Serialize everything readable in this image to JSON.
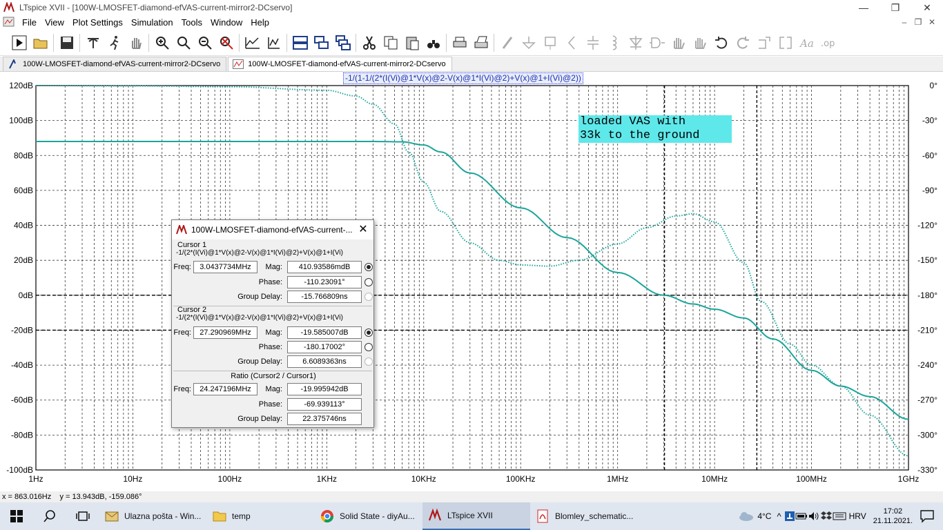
{
  "window": {
    "title": "LTspice XVII - [100W-LMOSFET-diamond-efVAS-current-mirror2-DCservo]",
    "controls": [
      "—",
      "❐",
      "✕"
    ]
  },
  "menu": {
    "items": [
      "File",
      "View",
      "Plot Settings",
      "Simulation",
      "Tools",
      "Window",
      "Help"
    ],
    "mdi_controls": [
      "–",
      "❐",
      "✕"
    ]
  },
  "toolbar": {
    "buttons": [
      "run-icon",
      "open-icon",
      "save-icon",
      "control-panel-icon",
      "run-man-icon",
      "pan-hand-icon",
      "zoom-in-icon",
      "zoom-full-icon",
      "zoom-out-icon",
      "zoom-cancel-icon",
      "autorange-icon",
      "add-trace-icon",
      "tile-h-icon",
      "tile-v-icon",
      "cascade-icon",
      "cut-icon",
      "copy-icon",
      "paste-icon",
      "find-icon",
      "print-icon",
      "print-setup-icon",
      "wire-icon",
      "ground-icon",
      "label-icon",
      "resistor-icon",
      "capacitor-icon",
      "inductor-icon",
      "diode-icon",
      "component-icon",
      "move-icon",
      "drag-icon",
      "undo-icon",
      "redo-icon",
      "rotate-icon",
      "mirror-icon",
      "text-icon",
      "spice-directive-icon"
    ]
  },
  "tabs": [
    {
      "label": "100W-LMOSFET-diamond-efVAS-current-mirror2-DCservo",
      "icon": "schematic-icon"
    },
    {
      "label": "100W-LMOSFET-diamond-efVAS-current-mirror2-DCservo",
      "icon": "waveform-icon"
    }
  ],
  "trace_label": "-1/(1-1/(2*(I(Vi)@1*V(x)@2-V(x)@1*I(Vi)@2)+V(x)@1+I(Vi)@2))",
  "annotation": [
    "loaded VAS with",
    "33k to the ground"
  ],
  "chart_data": {
    "type": "line",
    "xscale": "log",
    "xlim_hz": [
      1,
      1000000000
    ],
    "x_ticks": [
      "1Hz",
      "10Hz",
      "100Hz",
      "1KHz",
      "10KHz",
      "100KHz",
      "1MHz",
      "10MHz",
      "100MHz",
      "1GHz"
    ],
    "y_left_ticks": [
      "120dB",
      "100dB",
      "80dB",
      "60dB",
      "40dB",
      "20dB",
      "0dB",
      "-20dB",
      "-40dB",
      "-60dB",
      "-80dB",
      "-100dB"
    ],
    "y_left_lim_db": [
      -100,
      120
    ],
    "y_right_ticks": [
      "0°",
      "-30°",
      "-60°",
      "-90°",
      "-120°",
      "-150°",
      "-180°",
      "-210°",
      "-240°",
      "-270°",
      "-300°",
      "-330°"
    ],
    "y_right_lim_deg": [
      -330,
      0
    ],
    "grid": true,
    "trace_color": "#1aa59a",
    "series": [
      {
        "style": "solid",
        "quantity": "magnitude_db",
        "x_hz": [
          1,
          10,
          100,
          1000,
          3000,
          6000,
          10000,
          15000,
          30000,
          100000,
          300000,
          1000000,
          3000000,
          6000000,
          10000000,
          20000000,
          40000000,
          100000000,
          200000000,
          400000000,
          1000000000
        ],
        "values": [
          88,
          88,
          88,
          88,
          88,
          87.8,
          86,
          82,
          70,
          50,
          33,
          13,
          0,
          -5,
          -8,
          -13,
          -25,
          -43,
          -52,
          -58,
          -71
        ]
      },
      {
        "style": "dotted",
        "quantity": "phase_deg",
        "x_hz": [
          1,
          10,
          100,
          1000,
          2000,
          3000,
          5000,
          7000,
          10000,
          15000,
          30000,
          60000,
          100000,
          200000,
          400000,
          1000000,
          2000000,
          4000000,
          6000000,
          10000000,
          20000000,
          30000000,
          60000000,
          100000000,
          200000000,
          400000000,
          1000000000
        ],
        "values": [
          0,
          -0.3,
          -1,
          -4,
          -9,
          -16,
          -33,
          -57,
          -83,
          -108,
          -135,
          -150,
          -154,
          -155,
          -150,
          -136,
          -122,
          -112,
          -110,
          -117,
          -152,
          -185,
          -222,
          -240,
          -258,
          -283,
          -318
        ]
      }
    ],
    "cursor_x_hz": [
      3043773.4,
      27290969
    ]
  },
  "dialog": {
    "title": "100W-LMOSFET-diamond-efVAS-current-...",
    "cursor1": {
      "caption": "Cursor 1",
      "expr": "-1/(2*(I(Vi)@1*V(x)@2-V(x)@1*I(Vi)@2)+V(x)@1+I(Vi)",
      "freq_label": "Freq:",
      "freq": "3.0437734MHz",
      "mag_label": "Mag:",
      "mag": "410.93586mdB",
      "phase_label": "Phase:",
      "phase": "-110.23091°",
      "gd_label": "Group Delay:",
      "gd": "-15.766809ns"
    },
    "cursor2": {
      "caption": "Cursor 2",
      "expr": "-1/(2*(I(Vi)@1*V(x)@2-V(x)@1*I(Vi)@2)+V(x)@1+I(Vi)",
      "freq_label": "Freq:",
      "freq": "27.290969MHz",
      "mag_label": "Mag:",
      "mag": "-19.585007dB",
      "phase_label": "Phase:",
      "phase": "-180.17002°",
      "gd_label": "Group Delay:",
      "gd": "6.6089363ns"
    },
    "ratio": {
      "caption": "Ratio (Cursor2 / Cursor1)",
      "freq_label": "Freq:",
      "freq": "24.247196MHz",
      "mag_label": "Mag:",
      "mag": "-19.995942dB",
      "phase_label": "Phase:",
      "phase": "-69.939113°",
      "gd_label": "Group Delay:",
      "gd": "22.375746ns"
    }
  },
  "status": "x = 863.016Hz    y = 13.943dB, -159.086°",
  "taskbar": {
    "apps": [
      {
        "label": "Ulazna pošta - Win...",
        "icon": "mail-icon"
      },
      {
        "label": "temp",
        "icon": "folder-icon"
      },
      {
        "label": "Solid State - diyAu...",
        "icon": "chrome-icon"
      },
      {
        "label": "LTspice XVII",
        "icon": "ltspice-icon",
        "active": true
      },
      {
        "label": "Blomley_schematic...",
        "icon": "pdf-icon"
      }
    ],
    "weather": "4°C",
    "language": "HRV",
    "time": "17:02",
    "date": "21.11.2021."
  }
}
